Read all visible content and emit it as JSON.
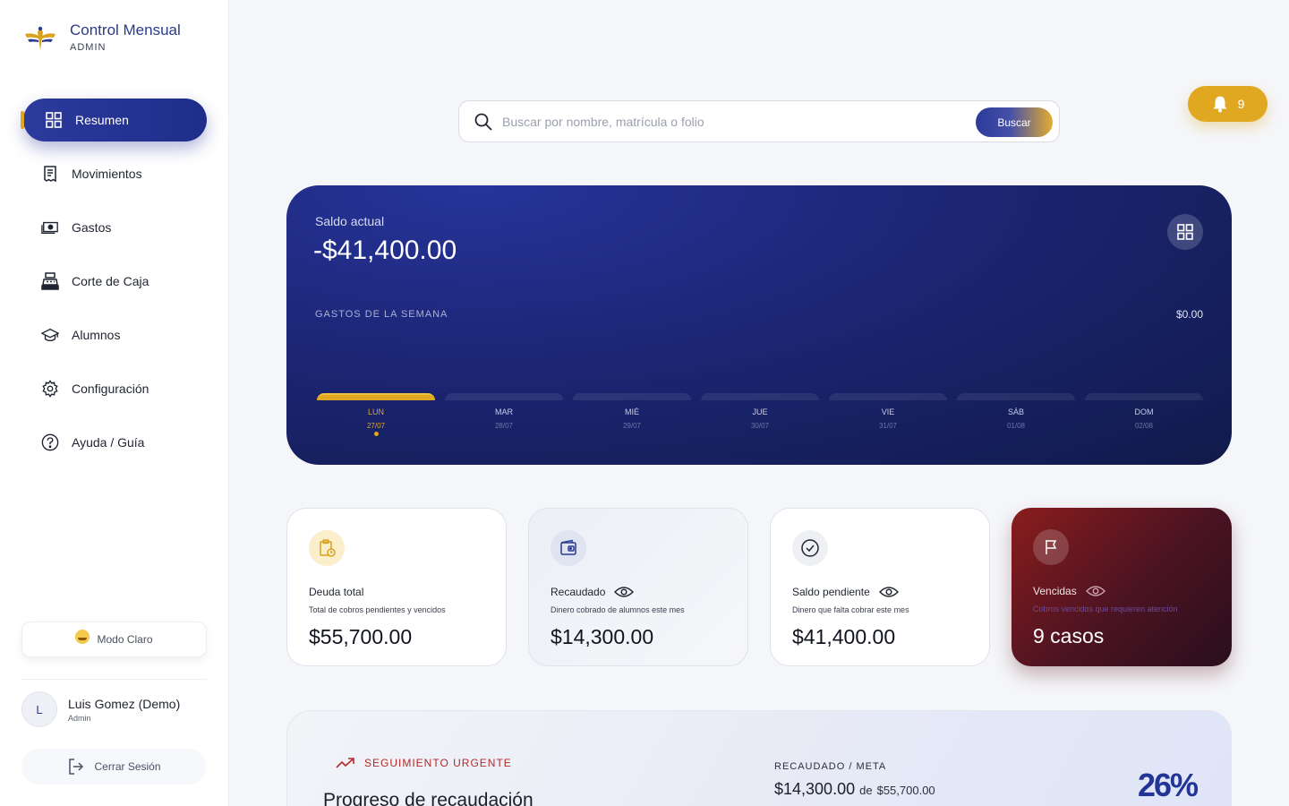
{
  "brand": {
    "title": "Control Mensual",
    "subtitle": "ADMIN"
  },
  "sidebar": {
    "items": [
      {
        "label": "Resumen",
        "icon": "grid-icon",
        "active": true
      },
      {
        "label": "Movimientos",
        "icon": "receipt-icon"
      },
      {
        "label": "Gastos",
        "icon": "cash-icon"
      },
      {
        "label": "Corte de Caja",
        "icon": "cash-register-icon"
      },
      {
        "label": "Alumnos",
        "icon": "graduation-cap-icon"
      },
      {
        "label": "Configuración",
        "icon": "gear-icon"
      },
      {
        "label": "Ayuda / Guía",
        "icon": "help-icon"
      }
    ],
    "mode_label": "Modo Claro",
    "user": {
      "initial": "L",
      "name": "Luis Gomez (Demo)",
      "role": "Admin"
    },
    "logout_label": "Cerrar Sesión"
  },
  "search": {
    "placeholder": "Buscar por nombre, matrícula o folio",
    "button_label": "Buscar"
  },
  "notifications": {
    "count": "9"
  },
  "balance": {
    "label": "Saldo actual",
    "value": "-$41,400.00",
    "week_label": "GASTOS DE LA SEMANA",
    "week_total": "$0.00",
    "days": [
      {
        "name": "LUN",
        "date": "27/07",
        "active": true
      },
      {
        "name": "MAR",
        "date": "28/07"
      },
      {
        "name": "MIÉ",
        "date": "29/07"
      },
      {
        "name": "JUE",
        "date": "30/07"
      },
      {
        "name": "VIE",
        "date": "31/07"
      },
      {
        "name": "SÁB",
        "date": "01/08"
      },
      {
        "name": "DOM",
        "date": "02/08"
      }
    ]
  },
  "cards": [
    {
      "title": "Deuda total",
      "desc": "Total de cobros pendientes y vencidos",
      "value": "$55,700.00"
    },
    {
      "title": "Recaudado",
      "desc": "Dinero cobrado de alumnos este mes",
      "value": "$14,300.00"
    },
    {
      "title": "Saldo pendiente",
      "desc": "Dinero que falta cobrar este mes",
      "value": "$41,400.00"
    },
    {
      "title": "Vencidas",
      "desc": "Cobros vencidos que requieren atención",
      "value": "9 casos"
    }
  ],
  "progress": {
    "tag": "SEGUIMIENTO URGENTE",
    "title": "Progreso de recaudación",
    "meta_label": "RECAUDADO / META",
    "collected": "$14,300.00",
    "of_text": "de",
    "goal": "$55,700.00",
    "percent": "26%"
  },
  "colors": {
    "primary": "#2b3a9c",
    "accent": "#e0a820",
    "danger": "#8a1d1d"
  }
}
